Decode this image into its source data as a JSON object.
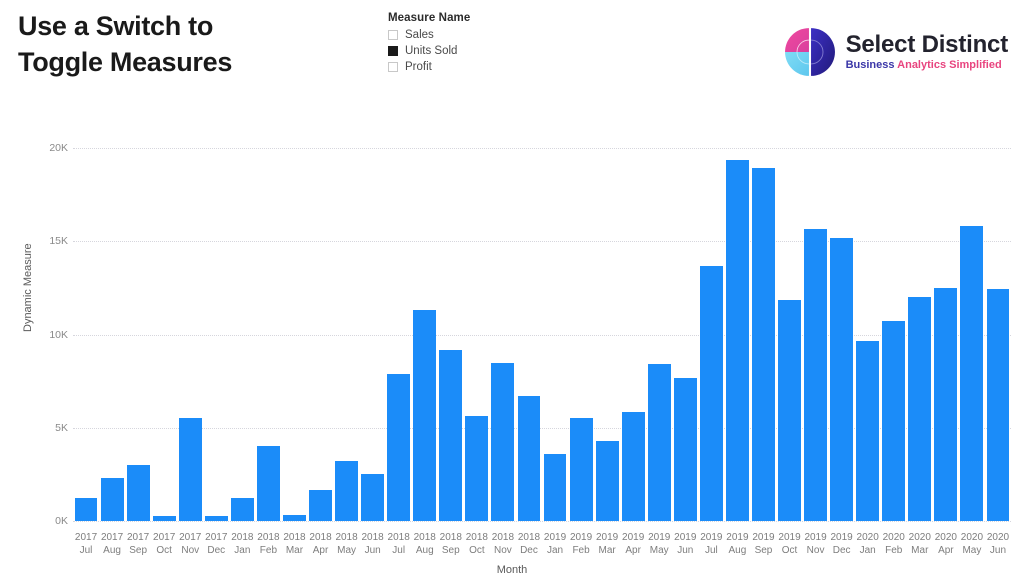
{
  "page": {
    "title": "Use a Switch to\nToggle Measures",
    "background_color": "#ffffff"
  },
  "legend": {
    "title": "Measure Name",
    "items": [
      {
        "label": "Sales",
        "checked": false
      },
      {
        "label": "Units Sold",
        "checked": true
      },
      {
        "label": "Profit",
        "checked": false
      }
    ]
  },
  "logo": {
    "name_bold": "Select",
    "name_light": "Distinct",
    "tagline_1": "Business ",
    "tagline_2": "Analytics ",
    "tagline_3": "Simplified",
    "mark_colors": {
      "pink": "#e8449b",
      "light_blue": "#6fd4f2",
      "dark_blue": "#2a1f9e",
      "mid_blue": "#3f2fc9"
    }
  },
  "chart_data": {
    "type": "bar",
    "title": "",
    "xlabel": "Month",
    "ylabel": "Dynamic Measure",
    "ylim": [
      0,
      20000
    ],
    "ytick_labels": [
      "0K",
      "5K",
      "10K",
      "15K",
      "20K"
    ],
    "ytick_values": [
      0,
      5000,
      10000,
      15000,
      20000
    ],
    "grid": true,
    "legend_position": "top",
    "bar_color": "#1b8cf9",
    "categories": [
      "2017 Jul",
      "2017 Aug",
      "2017 Sep",
      "2017 Oct",
      "2017 Nov",
      "2017 Dec",
      "2018 Jan",
      "2018 Feb",
      "2018 Mar",
      "2018 Apr",
      "2018 May",
      "2018 Jun",
      "2018 Jul",
      "2018 Aug",
      "2018 Sep",
      "2018 Oct",
      "2018 Nov",
      "2018 Dec",
      "2019 Jan",
      "2019 Feb",
      "2019 Mar",
      "2019 Apr",
      "2019 May",
      "2019 Jun",
      "2019 Jul",
      "2019 Aug",
      "2019 Sep",
      "2019 Oct",
      "2019 Nov",
      "2019 Dec",
      "2020 Jan",
      "2020 Feb",
      "2020 Mar",
      "2020 Apr",
      "2020 May",
      "2020 Jun"
    ],
    "category_years": [
      "2017",
      "2017",
      "2017",
      "2017",
      "2017",
      "2017",
      "2018",
      "2018",
      "2018",
      "2018",
      "2018",
      "2018",
      "2018",
      "2018",
      "2018",
      "2018",
      "2018",
      "2018",
      "2019",
      "2019",
      "2019",
      "2019",
      "2019",
      "2019",
      "2019",
      "2019",
      "2019",
      "2019",
      "2019",
      "2019",
      "2020",
      "2020",
      "2020",
      "2020",
      "2020",
      "2020"
    ],
    "category_months": [
      "Jul",
      "Aug",
      "Sep",
      "Oct",
      "Nov",
      "Dec",
      "Jan",
      "Feb",
      "Mar",
      "Apr",
      "May",
      "Jun",
      "Jul",
      "Aug",
      "Sep",
      "Oct",
      "Nov",
      "Dec",
      "Jan",
      "Feb",
      "Mar",
      "Apr",
      "May",
      "Jun",
      "Jul",
      "Aug",
      "Sep",
      "Oct",
      "Nov",
      "Dec",
      "Jan",
      "Feb",
      "Mar",
      "Apr",
      "May",
      "Jun"
    ],
    "series": [
      {
        "name": "Units Sold",
        "values": [
          1250,
          2300,
          3000,
          250,
          5500,
          250,
          1250,
          4000,
          300,
          1650,
          3200,
          2500,
          7900,
          11300,
          9150,
          5650,
          8450,
          6700,
          3600,
          5500,
          4300,
          5850,
          8400,
          7650,
          13700,
          19350,
          18950,
          11850,
          15650,
          15150,
          9650,
          10750,
          12000,
          12500,
          15800,
          12450
        ]
      }
    ]
  }
}
